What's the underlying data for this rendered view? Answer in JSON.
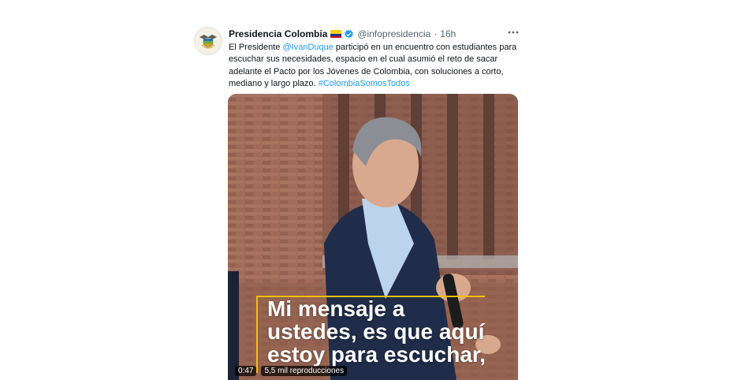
{
  "tweet": {
    "name": "Presidencia Colombia",
    "handle": "@infopresidencia",
    "separator": "·",
    "time": "16h",
    "text": {
      "part1": "El Presidente ",
      "mention": "@IvanDuque",
      "part2": " participó en un encuentro con estudiantes para escuchar sus necesidades, espacio en el cual asumió el reto de sacar adelante el Pacto por los Jóvenes de Colombia, con soluciones a corto, mediano y largo plazo. ",
      "hashtag": "#ColombiaSomosTodos"
    },
    "icons": {
      "avatar": "colombia-coat-of-arms-avatar",
      "flag": "colombia-flag-emoji",
      "verified": "verified-badge-icon",
      "more": "more-options-icon"
    },
    "colors": {
      "accent": "#1d9bf0",
      "caption_border": "#f2c200"
    }
  },
  "video": {
    "caption_lines": [
      "Mi mensaje a",
      "ustedes, es que aquí",
      "estoy para escuchar,"
    ],
    "duration": "0:47",
    "views": "5,5 mil reproducciones"
  }
}
